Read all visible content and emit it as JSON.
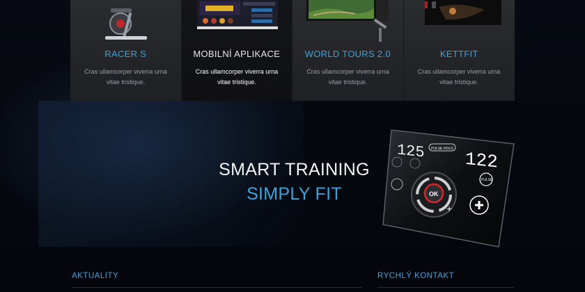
{
  "products": [
    {
      "title": "RACER S",
      "description": "Cras ullamcorper viverra urna vitae tristique.",
      "active": false,
      "image": "exercise-bike-image"
    },
    {
      "title": "MOBILNÍ APLIKACE",
      "description": "Cras ullamcorper viverra urna vitae tristique.",
      "active": true,
      "image": "mobile-app-screenshot"
    },
    {
      "title": "WORLD TOURS 2.0",
      "description": "Cras ullamcorper viverra urna vitae tristique.",
      "active": false,
      "image": "tablet-map-image"
    },
    {
      "title": "KETTFIT",
      "description": "Cras ullamcorper viverra urna vitae tristique.",
      "active": false,
      "image": "kettfit-device-image"
    }
  ],
  "hero": {
    "line1": "SMART TRAINING",
    "line2": "SIMPLY FIT",
    "console": {
      "left_readout": "125",
      "right_readout": "122",
      "center_button": "OK",
      "mode_label": "PULSE·HOLD",
      "pulse_label": "PULSE"
    }
  },
  "footer": {
    "news_title": "AKTUALITY",
    "contact_title": "RYCHLÝ KONTAKT"
  },
  "colors": {
    "accent": "#3ea3d8",
    "background": "#050810",
    "card": "#2a2c30",
    "card_active": "#141518"
  }
}
